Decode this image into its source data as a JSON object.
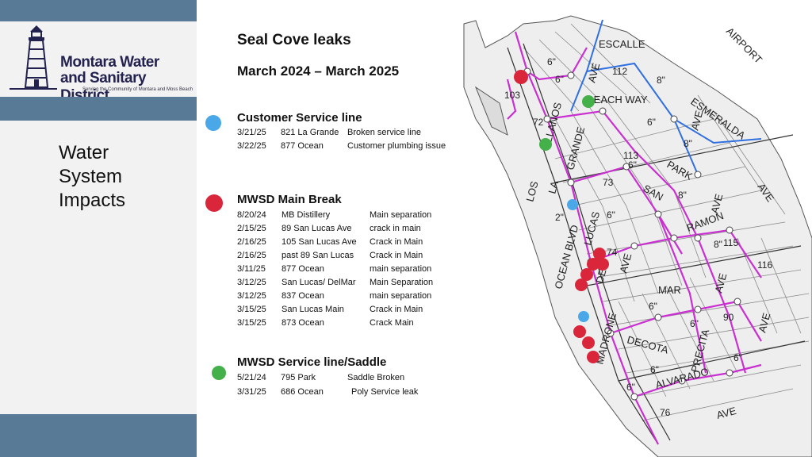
{
  "slide": {
    "heading_left": [
      "Water",
      "System",
      "Impacts"
    ],
    "title": "Seal Cove leaks",
    "subtitle": "March  2024 – March 2025"
  },
  "logo": {
    "line1": "Montara Water",
    "line2": "and Sanitary District",
    "tagline": "Serving the Community of Montara and Moss Beach",
    "icon": "lighthouse-icon"
  },
  "colors": {
    "band": "#587a96",
    "customer": "#4aa8e8",
    "main_break": "#d9263b",
    "service_saddle": "#43b04a",
    "main_pipe": "#c92fd1",
    "blue_pipe": "#2f6fe0"
  },
  "sections": {
    "customer": {
      "heading": "Customer Service line",
      "rows": [
        {
          "date": "3/21/25",
          "location": "821 La Grande",
          "issue": "Broken service line"
        },
        {
          "date": "3/22/25",
          "location": "877 Ocean",
          "issue": "Customer plumbing issue"
        }
      ]
    },
    "main_break": {
      "heading": "MWSD Main Break",
      "rows": [
        {
          "date": "8/20/24",
          "location": "MB Distillery",
          "issue": "Main separation"
        },
        {
          "date": "2/15/25",
          "location": "89 San Lucas Ave",
          "issue": "crack in main"
        },
        {
          "date": "2/16/25",
          "location": "105 San Lucas Ave",
          "issue": "Crack in Main"
        },
        {
          "date": "2/16/25",
          "location": "past 89 San Lucas",
          "issue": "Crack in Main"
        },
        {
          "date": "3/11/25",
          "location": "877 Ocean",
          "issue": "main separation"
        },
        {
          "date": "3/12/25",
          "location": "San Lucas/ DelMar",
          "issue": "Main Separation"
        },
        {
          "date": "3/12/25",
          "location": "837 Ocean",
          "issue": "main separation"
        },
        {
          "date": "3/15/25",
          "location": "San Lucas Main",
          "issue": "Crack in Main"
        },
        {
          "date": "3/15/25",
          "location": "873 Ocean",
          "issue": "Crack Main"
        }
      ]
    },
    "service_saddle": {
      "heading": "MWSD Service line/Saddle",
      "rows": [
        {
          "date": "5/21/24",
          "location": "795 Park",
          "issue": "Saddle Broken"
        },
        {
          "date": "3/31/25",
          "location": "686 Ocean",
          "issue": "Poly Service leak"
        }
      ]
    }
  },
  "map": {
    "streets": {
      "escalle": "ESCALLE",
      "beach_way": "BEACH WAY",
      "esmeralda": "ESMERALDA",
      "airport": "AIRPORT",
      "park": "PARK",
      "san": "SAN",
      "lucas": "LUCAS",
      "los": "LOS",
      "la": "LA",
      "grande": "GRANDE",
      "llanos": "LLANOS",
      "ocean_blvd": "OCEAN BLVD",
      "ramon": "RAMON",
      "del": "DEL",
      "mar": "MAR",
      "madrone": "MADRONE",
      "decota": "DECOTA",
      "precita": "PRECITA",
      "alvarado": "ALVARADO",
      "ave": "AVE",
      "dela": "DEL A",
      "ave_short": "AV"
    },
    "pipe_label": "6\"",
    "pipe_label_8": "8\"",
    "pipe_label_2": "2\"",
    "numbers": {
      "n103": "103",
      "n72": "72",
      "n112": "112",
      "n113": "113",
      "n73": "73",
      "n115": "115",
      "n114": "114",
      "n90": "90",
      "n76": "76",
      "n74": "74",
      "n116": "116"
    }
  }
}
